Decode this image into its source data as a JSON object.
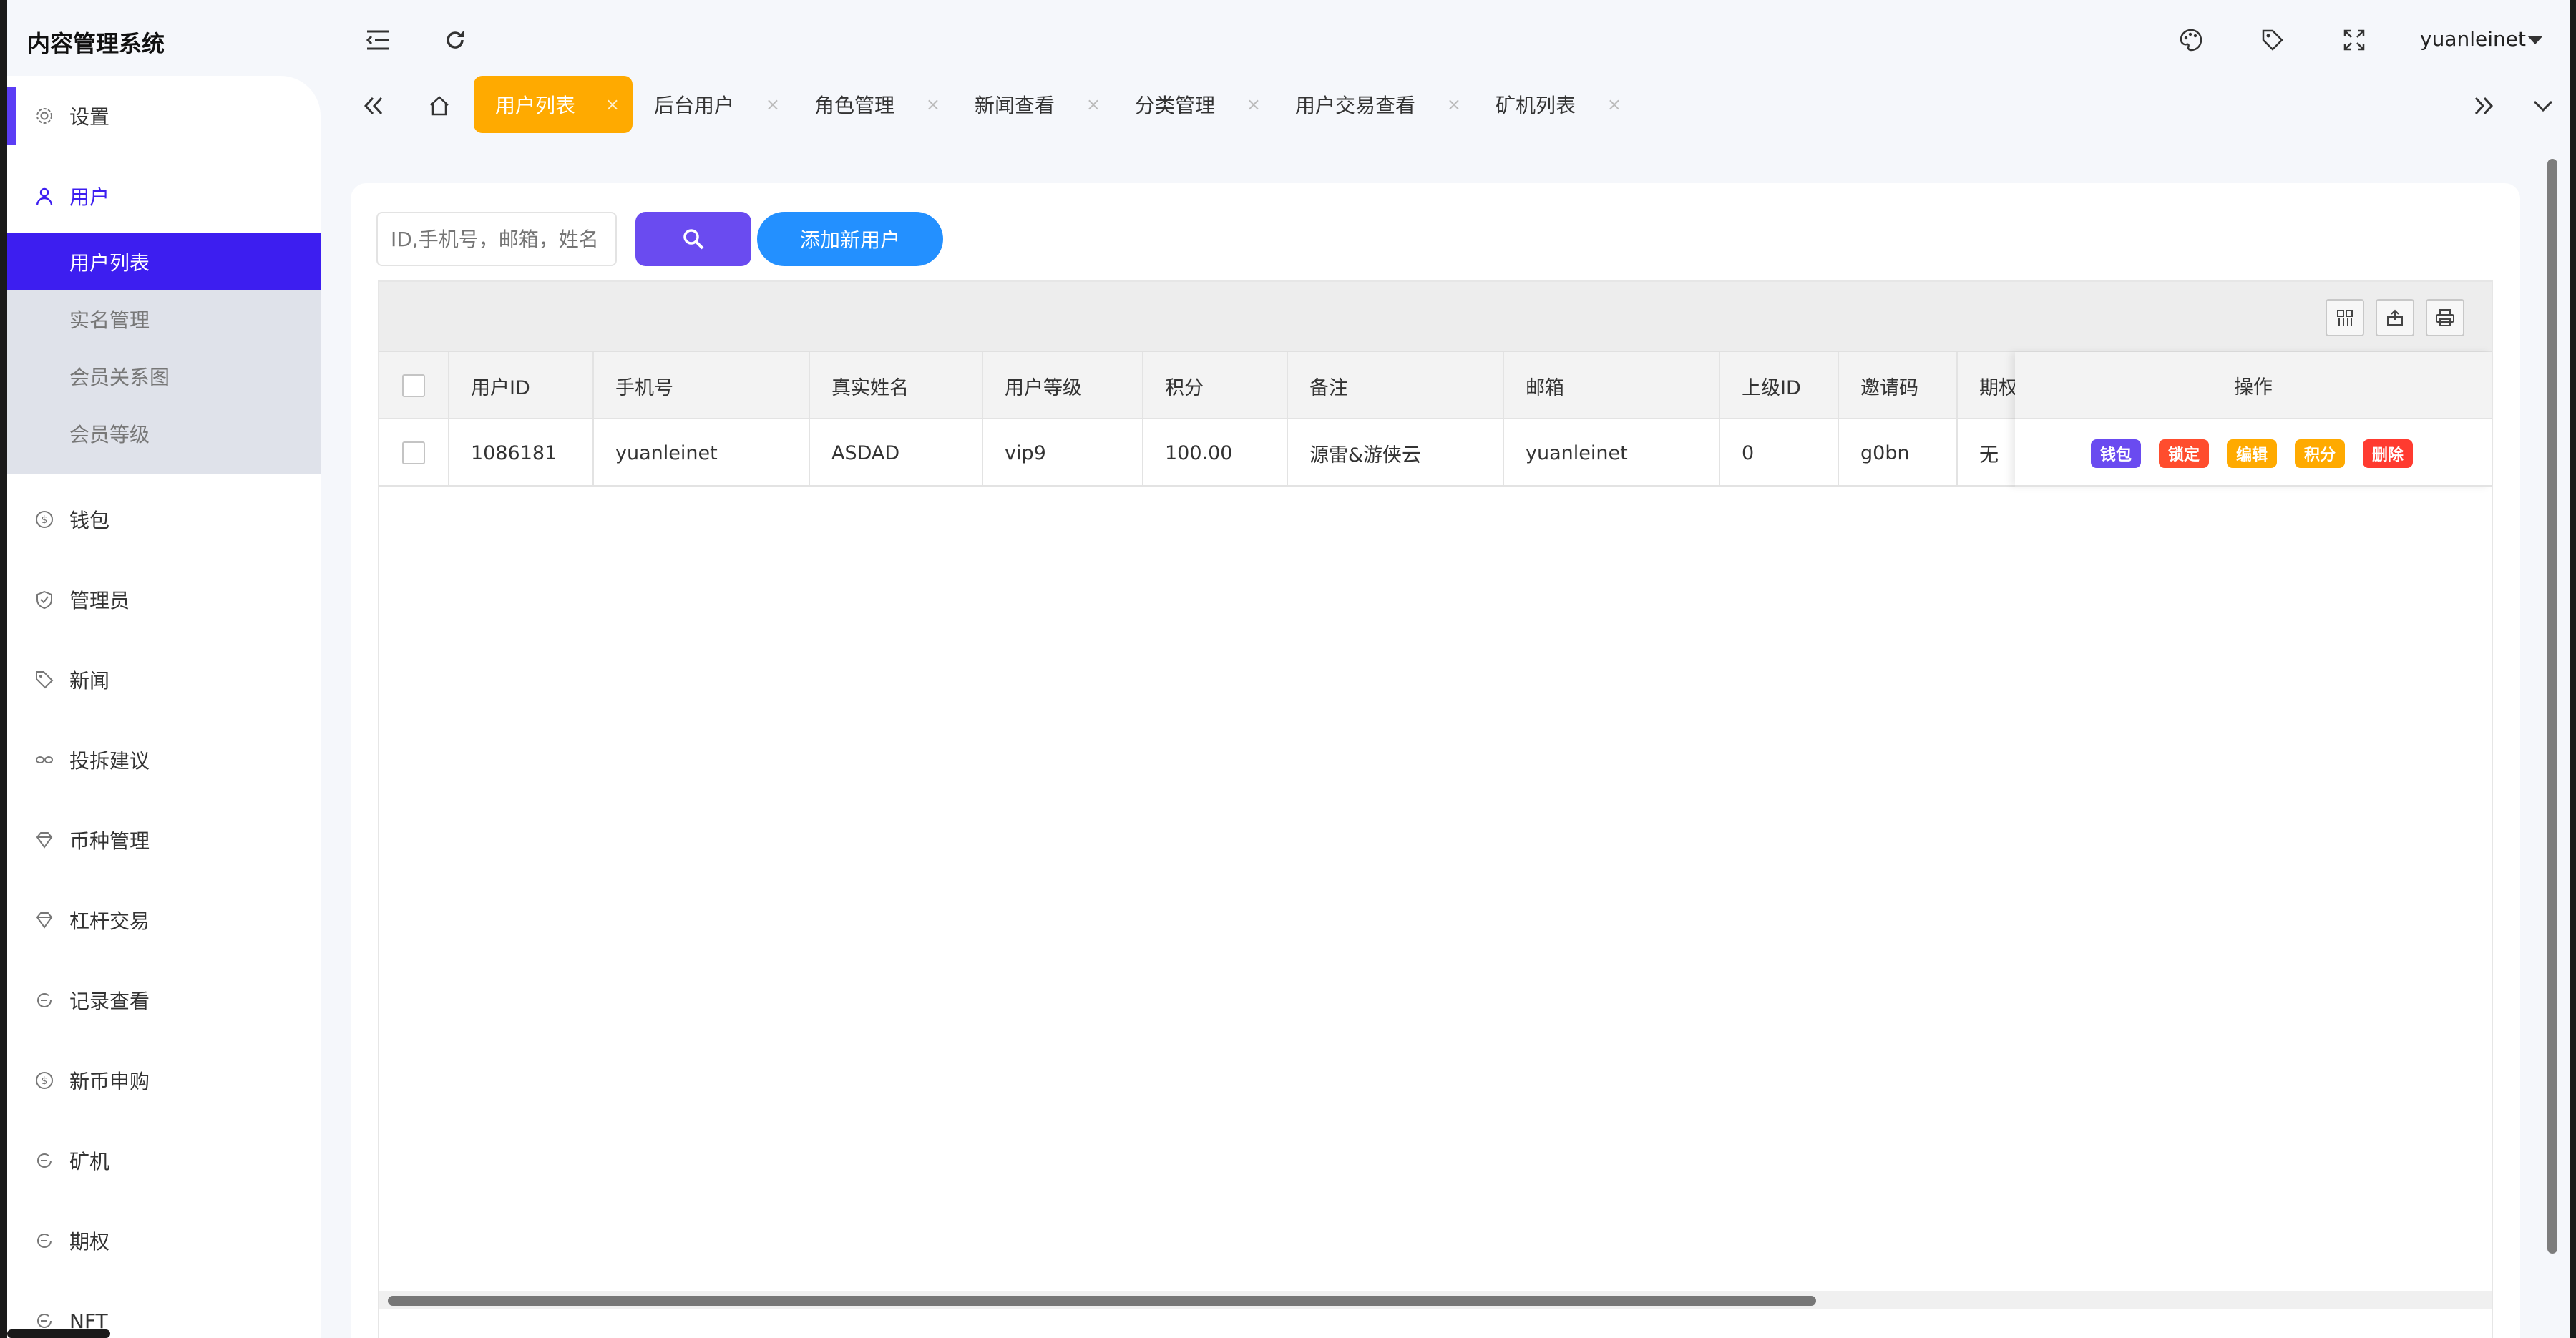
{
  "header": {
    "app_title": "内容管理系统",
    "user_name": "yuanleinet",
    "icons": [
      "menu-fold-icon",
      "refresh-icon",
      "theme-palette-icon",
      "tag-icon",
      "fullscreen-icon"
    ]
  },
  "sidebar": {
    "items": [
      {
        "label": "设置",
        "icon": "gear-icon"
      },
      {
        "label": "用户",
        "icon": "user-icon",
        "active": true
      },
      {
        "label": "钱包",
        "icon": "dollar-icon"
      },
      {
        "label": "管理员",
        "icon": "shield-icon"
      },
      {
        "label": "新闻",
        "icon": "tag-icon"
      },
      {
        "label": "投拆建议",
        "icon": "link-icon"
      },
      {
        "label": "币种管理",
        "icon": "diamond-icon"
      },
      {
        "label": "杠杆交易",
        "icon": "diamond-icon"
      },
      {
        "label": "记录查看",
        "icon": "circle-arrow-icon"
      },
      {
        "label": "新币申购",
        "icon": "dollar-icon"
      },
      {
        "label": "矿机",
        "icon": "circle-arrow-icon"
      },
      {
        "label": "期权",
        "icon": "circle-arrow-icon"
      },
      {
        "label": "NFT",
        "icon": "circle-arrow-icon"
      }
    ],
    "sub_items": [
      "用户列表",
      "实名管理",
      "会员关系图",
      "会员等级"
    ]
  },
  "tabs": [
    "用户列表",
    "后台用户",
    "角色管理",
    "新闻查看",
    "分类管理",
    "用户交易查看",
    "矿机列表"
  ],
  "search": {
    "placeholder": "ID,手机号，邮箱，姓名",
    "add_button": "添加新用户"
  },
  "table": {
    "columns": [
      "用户ID",
      "手机号",
      "真实姓名",
      "用户等级",
      "积分",
      "备注",
      "邮箱",
      "上级ID",
      "邀请码",
      "期权",
      "操作"
    ],
    "rows": [
      {
        "cells": [
          "1086181",
          "yuanleinet",
          "ASDAD",
          "vip9",
          "100.00",
          "源雷&游侠云",
          "yuanleinet",
          "0",
          "g0bn",
          "无"
        ],
        "actions": [
          "钱包",
          "锁定",
          "编辑",
          "积分",
          "删除"
        ]
      }
    ]
  },
  "colors": {
    "accent": "#3d1ef0",
    "tab_active": "#ffaa00",
    "search_button": "#6a4bf0",
    "add_button": "#2390ff",
    "action_wallet": "#6a4bf0",
    "action_lock": "#ff4d2e",
    "action_edit": "#ffaa00",
    "action_points": "#ffaa00",
    "action_delete": "#ff3b30"
  }
}
